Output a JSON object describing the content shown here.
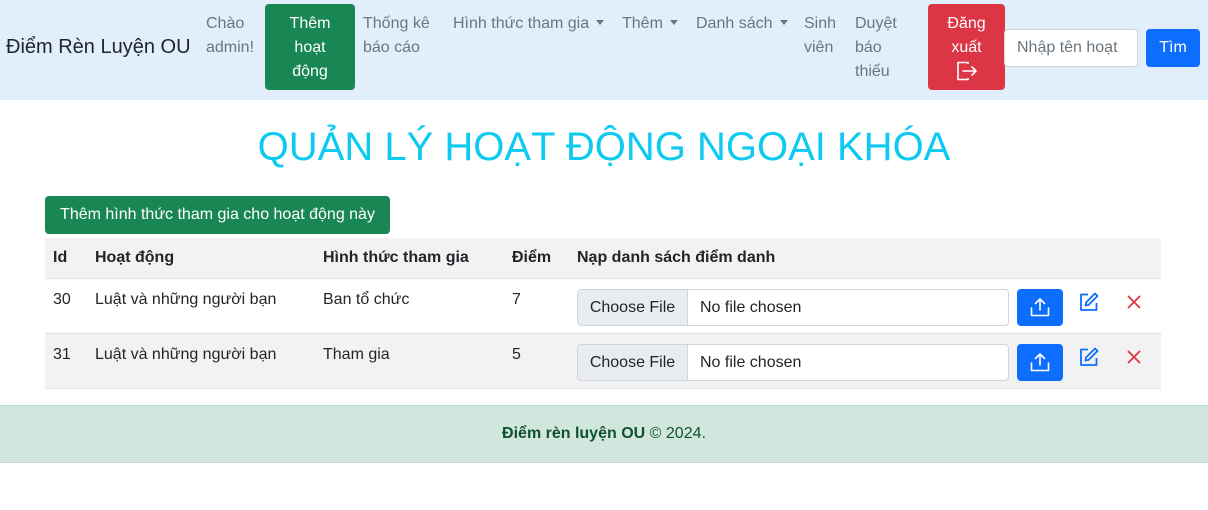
{
  "navbar": {
    "brand": "Điểm Rèn Luyện OU",
    "greeting": [
      "Chào",
      "admin!"
    ],
    "add_activity": [
      "Thêm",
      "hoạt",
      "động"
    ],
    "reports": [
      "Thống kê",
      "báo cáo"
    ],
    "participation_menu": "Hình thức tham gia",
    "add_menu": "Thêm",
    "list_menu": "Danh sách",
    "students": [
      "Sinh",
      "viên"
    ],
    "approve_reports": [
      "Duyệt",
      "báo",
      "thiếu"
    ],
    "logout": [
      "Đăng",
      "xuất"
    ],
    "search_placeholder": "Nhập tên hoạt",
    "search_button": "Tìm"
  },
  "page": {
    "title": "QUẢN LÝ HOẠT ĐỘNG NGOẠI KHÓA",
    "add_form_button": "Thêm hình thức tham gia cho hoạt động này"
  },
  "table": {
    "headers": {
      "id": "Id",
      "activity": "Hoạt động",
      "form": "Hình thức tham gia",
      "points": "Điểm",
      "attendance": "Nạp danh sách điểm danh"
    },
    "rows": [
      {
        "id": "30",
        "activity": "Luật và những người bạn",
        "form": "Ban tổ chức",
        "points": "7",
        "file_button": "Choose File",
        "file_status": "No file chosen"
      },
      {
        "id": "31",
        "activity": "Luật và những người bạn",
        "form": "Tham gia",
        "points": "5",
        "file_button": "Choose File",
        "file_status": "No file chosen"
      }
    ]
  },
  "footer": {
    "brand": "Điểm rèn luyện OU",
    "copyright": "© 2024."
  },
  "colors": {
    "navbar_bg": "#e1eefb",
    "success": "#198754",
    "danger": "#dc3545",
    "primary": "#0d6efd",
    "title": "#0dcaf0",
    "footer_bg": "#d1e7dd"
  }
}
